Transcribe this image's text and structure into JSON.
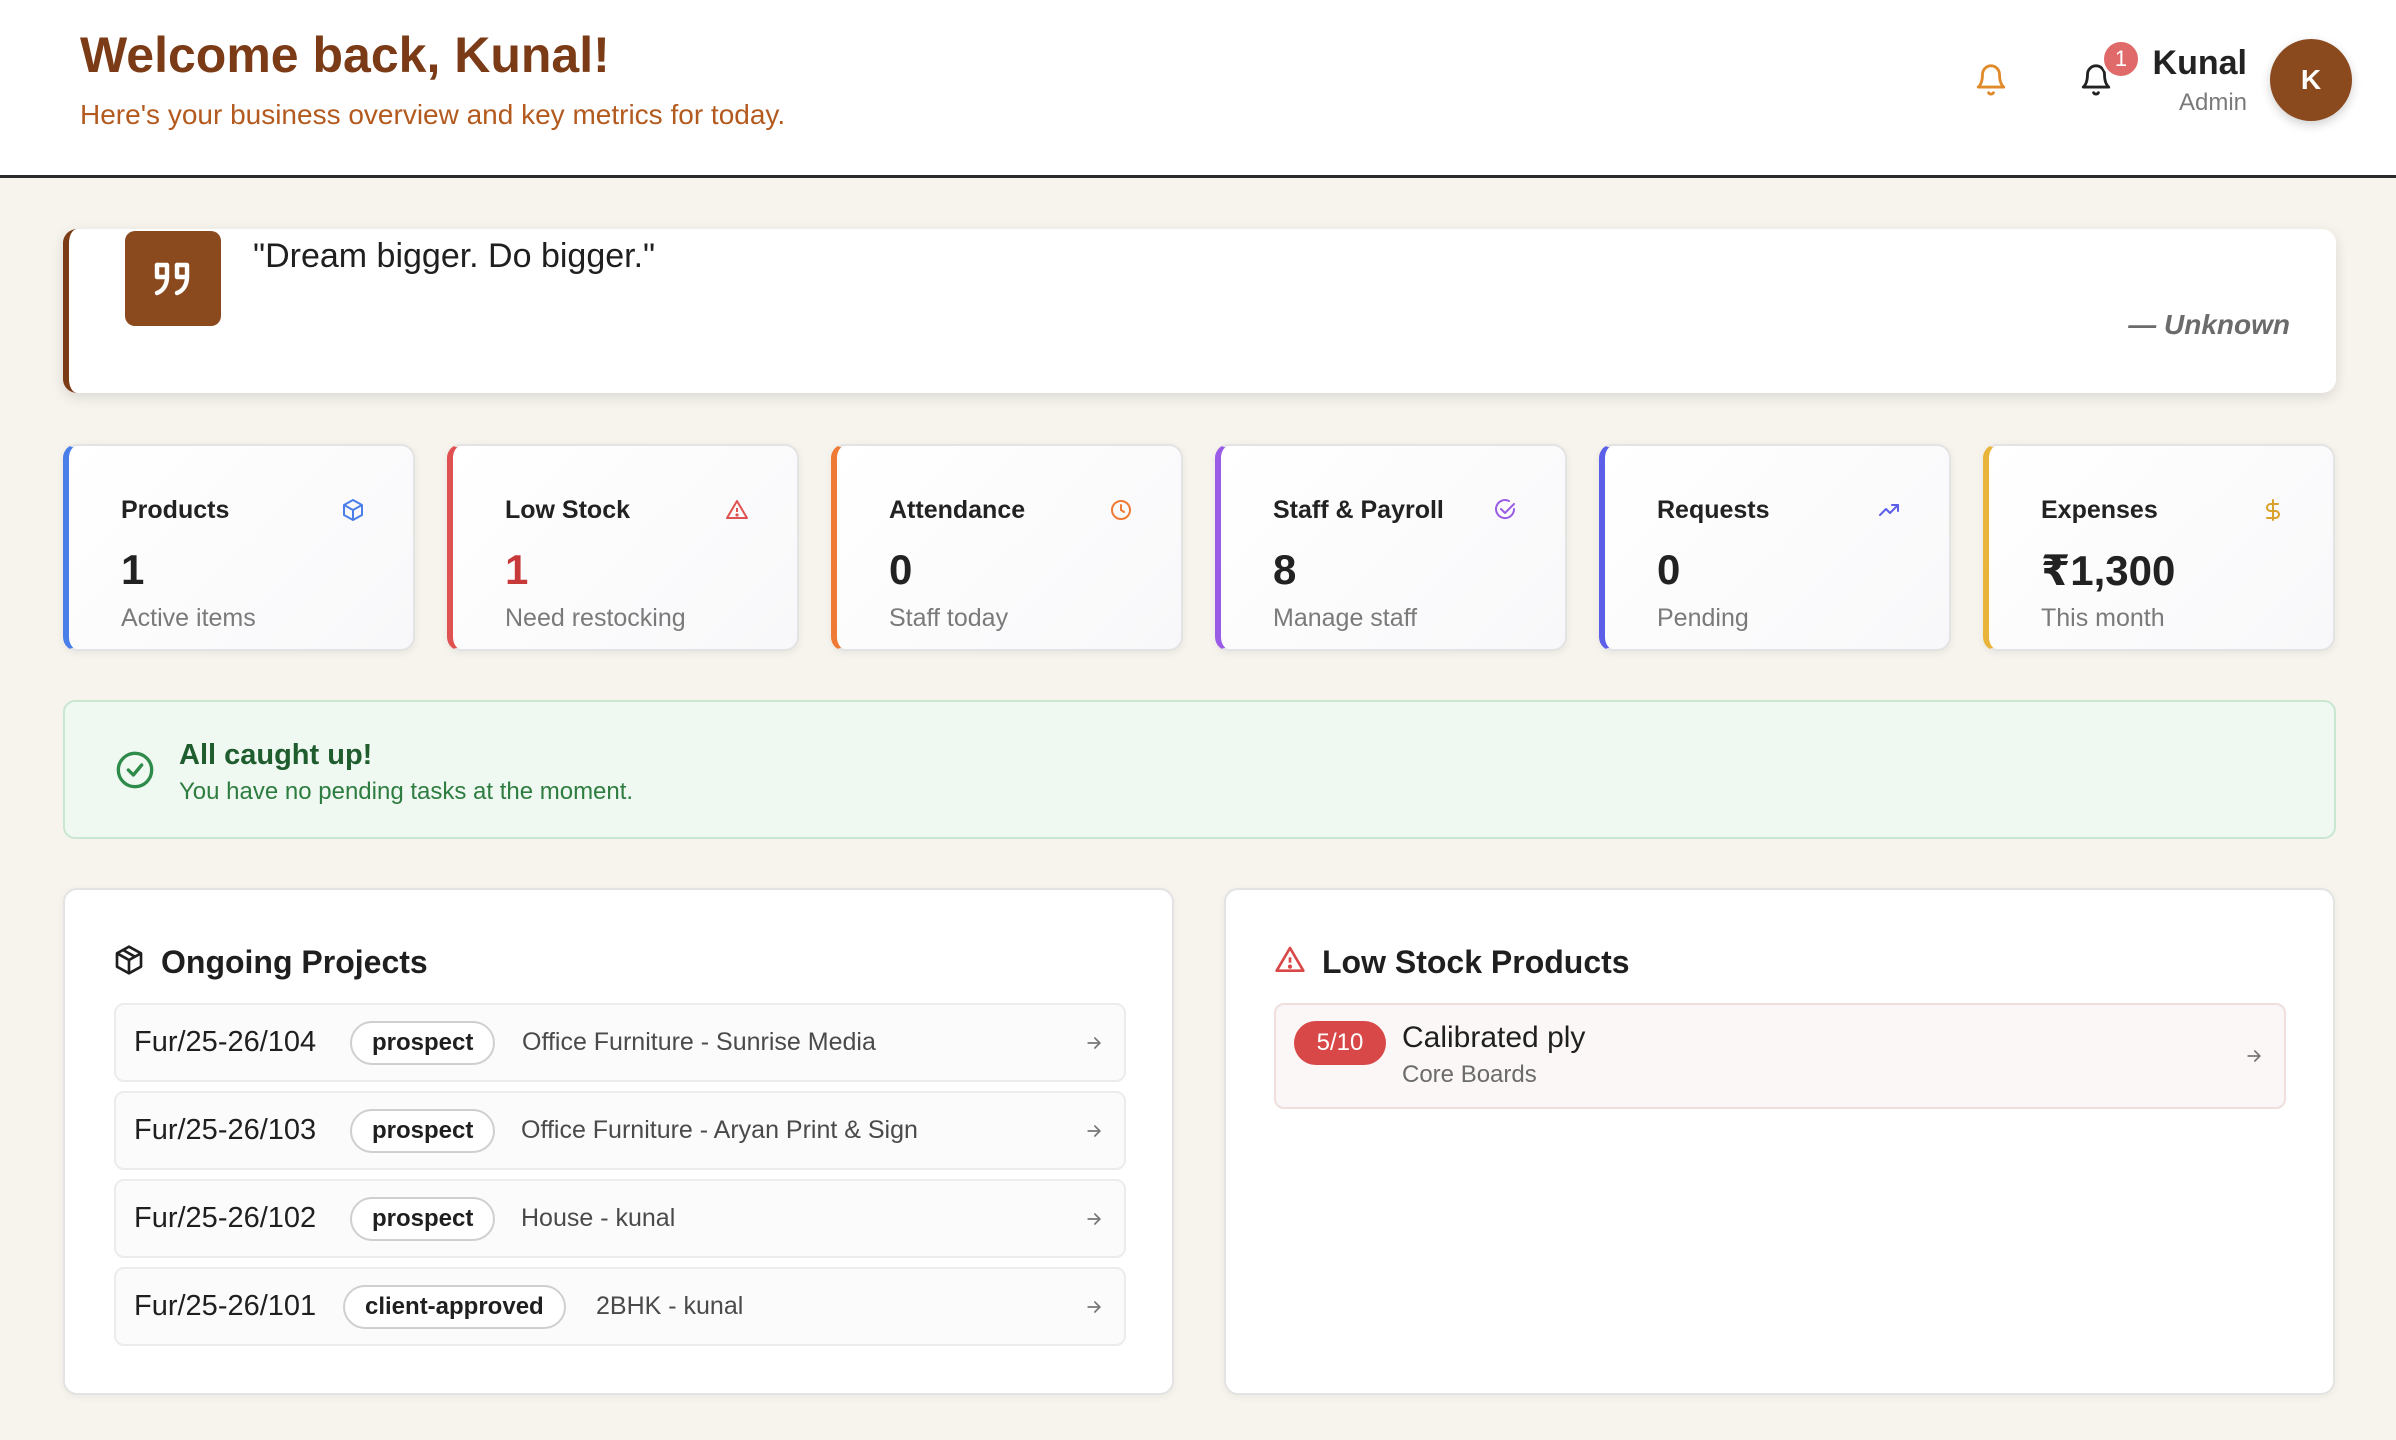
{
  "header": {
    "title": "Welcome back, Kunal!",
    "subtitle": "Here's your business overview and key metrics for today.",
    "notification_count": "1",
    "user_name": "Kunal",
    "user_role": "Admin",
    "avatar_initial": "K"
  },
  "quote": {
    "text": "\"Dream bigger. Do bigger.\"",
    "author": "— Unknown"
  },
  "stats": [
    {
      "title": "Products",
      "value": "1",
      "subtitle": "Active items",
      "accent": "#4a7ee8",
      "icon": "box-icon"
    },
    {
      "title": "Low Stock",
      "value": "1",
      "subtitle": "Need restocking",
      "accent": "#e05252",
      "icon": "alert-triangle-icon"
    },
    {
      "title": "Attendance",
      "value": "0",
      "subtitle": "Staff today",
      "accent": "#ee7a35",
      "icon": "clock-icon"
    },
    {
      "title": "Staff & Payroll",
      "value": "8",
      "subtitle": "Manage staff",
      "accent": "#9a5ce6",
      "icon": "check-circle-icon"
    },
    {
      "title": "Requests",
      "value": "0",
      "subtitle": "Pending",
      "accent": "#5b5ee8",
      "icon": "trending-up-icon"
    },
    {
      "title": "Expenses",
      "value": "₹1,300",
      "subtitle": "This month",
      "accent": "#e8b43a",
      "icon": "dollar-icon"
    }
  ],
  "caught_up": {
    "title": "All caught up!",
    "subtitle": "You have no pending tasks at the moment."
  },
  "projects": {
    "title": "Ongoing Projects",
    "rows": [
      {
        "code": "Fur/25-26/104",
        "status": "prospect",
        "name": "Office Furniture - Sunrise Media"
      },
      {
        "code": "Fur/25-26/103",
        "status": "prospect",
        "name": "Office Furniture - Aryan Print & Sign"
      },
      {
        "code": "Fur/25-26/102",
        "status": "prospect",
        "name": "House - kunal"
      },
      {
        "code": "Fur/25-26/101",
        "status": "client-approved",
        "name": "2BHK - kunal"
      }
    ]
  },
  "low_stock": {
    "title": "Low Stock Products",
    "items": [
      {
        "qty": "5/10",
        "name": "Calibrated ply",
        "category": "Core Boards"
      }
    ]
  }
}
